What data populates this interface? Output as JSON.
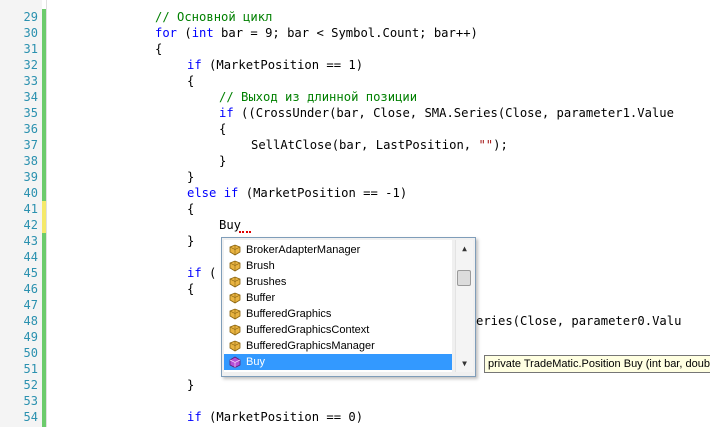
{
  "editor": {
    "line_numbers": [
      "29",
      "30",
      "31",
      "32",
      "33",
      "34",
      "35",
      "36",
      "37",
      "38",
      "39",
      "40",
      "41",
      "42",
      "43",
      "44",
      "45",
      "46",
      "47",
      "48",
      "49",
      "50",
      "51",
      "52",
      "53",
      "54"
    ],
    "lines": {
      "l29": "// Основной цикл",
      "l30": {
        "kw1": "for",
        "a": " (",
        "kw2": "int",
        "b": " bar = 9; bar < Symbol.Count; bar++)"
      },
      "l31": "{",
      "l32": {
        "kw": "if",
        "rest": " (MarketPosition == 1)"
      },
      "l33": "{",
      "l34": "// Выход из длинной позиции",
      "l35": {
        "kw": "if",
        "rest": " ((CrossUnder(bar, Close, SMA.Series(Close, parameter1.Value"
      },
      "l36": "{",
      "l37": {
        "a": "SellAtClose(bar, LastPosition, ",
        "str": "\"\"",
        "b": ");"
      },
      "l38": "}",
      "l39": "}",
      "l40": {
        "kw1": "else",
        "a": " ",
        "kw2": "if",
        "rest": " (MarketPosition == -1)"
      },
      "l41": "{",
      "l42": "Buy",
      "l43": "}",
      "l44": "",
      "l45": {
        "kw": "if",
        "rest": " ("
      },
      "l46": "{",
      "l48": "eries(Close, parameter0.Valu",
      "l52": "}",
      "l54": {
        "kw": "if",
        "rest": " (MarketPosition == 0)"
      }
    }
  },
  "completion": {
    "items": [
      "BrokerAdapterManager",
      "Brush",
      "Brushes",
      "Buffer",
      "BufferedGraphics",
      "BufferedGraphicsContext",
      "BufferedGraphicsManager",
      "Buy"
    ],
    "selected_index": 7,
    "scroll_up_arrow": "▲",
    "scroll_down_arrow": "▼"
  },
  "tooltip": {
    "text": "private TradeMatic.Position Buy (int bar, double"
  },
  "colors": {
    "keyword": "#0000ff",
    "comment": "#008000",
    "line_number": "#2b91af",
    "selection": "#3399ff",
    "tooltip_bg": "#ffffe1"
  },
  "icons": {
    "class": "class-icon",
    "method": "method-icon"
  }
}
